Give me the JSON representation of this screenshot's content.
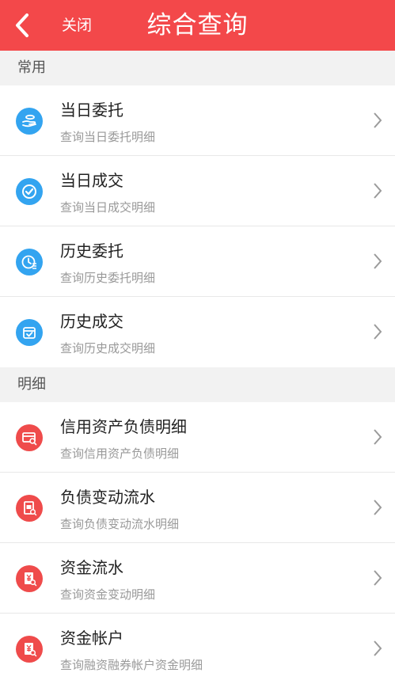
{
  "header": {
    "close_label": "关闭",
    "title": "综合查询",
    "bg_color": "#f3484a"
  },
  "sections": [
    {
      "label": "常用",
      "icon_color": "#33a4f0",
      "items": [
        {
          "title": "当日委托",
          "subtitle": "查询当日委托明细",
          "icon": "hand-coin-icon"
        },
        {
          "title": "当日成交",
          "subtitle": "查询当日成交明细",
          "icon": "check-circle-icon"
        },
        {
          "title": "历史委托",
          "subtitle": "查询历史委托明细",
          "icon": "clock-list-icon"
        },
        {
          "title": "历史成交",
          "subtitle": "查询历史成交明细",
          "icon": "box-check-icon"
        }
      ]
    },
    {
      "label": "明细",
      "icon_color": "#ef4b4b",
      "items": [
        {
          "title": "信用资产负债明细",
          "subtitle": "查询信用资产负债明细",
          "icon": "card-search-icon"
        },
        {
          "title": "负债变动流水",
          "subtitle": "查询负债变动流水明细",
          "icon": "document-search-icon"
        },
        {
          "title": "资金流水",
          "subtitle": "查询资金变动明细",
          "icon": "yuan-flow-icon"
        },
        {
          "title": "资金帐户",
          "subtitle": "查询融资融券帐户资金明细",
          "icon": "yuan-account-icon"
        }
      ]
    }
  ]
}
